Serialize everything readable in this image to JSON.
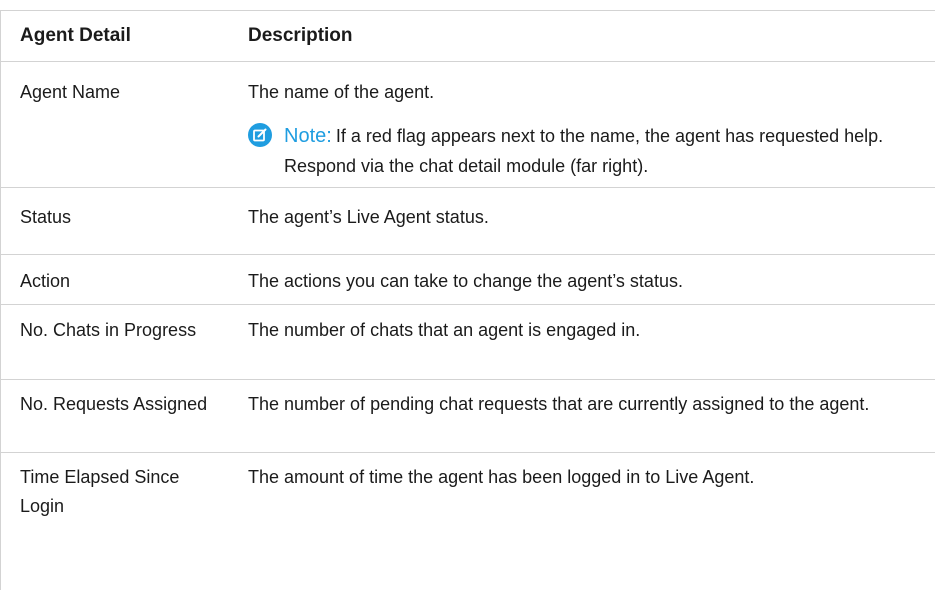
{
  "table": {
    "headers": {
      "detail": "Agent Detail",
      "description": "Description"
    },
    "rows": [
      {
        "detail": "Agent Name",
        "description": "The name of the agent.",
        "note": {
          "label": "Note:",
          "text": "If a red flag appears next to the name, the agent has requested help. Respond via the chat detail module (far right)."
        }
      },
      {
        "detail": "Status",
        "description": "The agent’s Live Agent status."
      },
      {
        "detail": "Action",
        "description": "The actions you can take to change the agent’s status."
      },
      {
        "detail": "No. Chats in Progress",
        "description": "The number of chats that an agent is engaged in."
      },
      {
        "detail": "No. Requests Assigned",
        "description": "The number of pending chat requests that are currently assigned to the agent."
      },
      {
        "detail": "Time Elapsed Since Login",
        "description": "The amount of time the agent has been logged in to Live Agent."
      }
    ]
  },
  "colors": {
    "accent": "#1f9de0",
    "border": "#d3d3d3",
    "text": "#1b1b1b"
  },
  "icons": {
    "note": "note-edit-icon"
  }
}
